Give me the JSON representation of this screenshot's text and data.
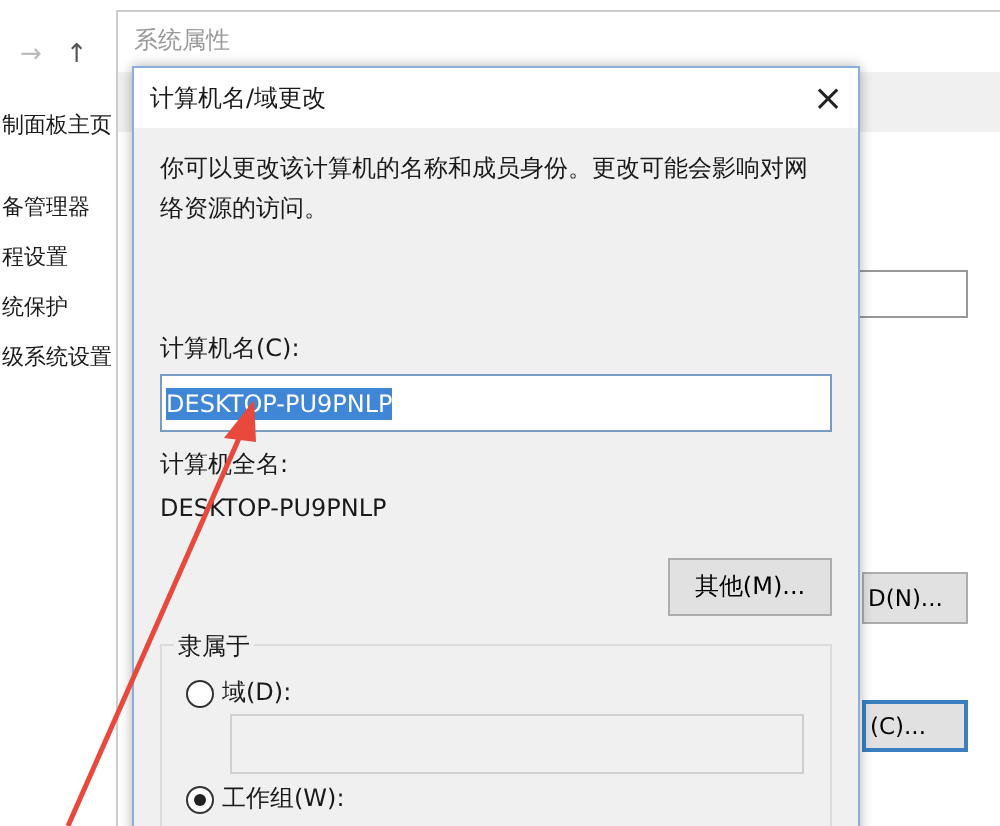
{
  "control_panel": {
    "nav": [
      "→",
      "↑"
    ],
    "sidebar": {
      "items": [
        {
          "label": "制面板主页"
        },
        {
          "label": "备管理器"
        },
        {
          "label": "程设置"
        },
        {
          "label": "统保护"
        },
        {
          "label": "级系统设置"
        }
      ]
    }
  },
  "system_properties": {
    "title": "系统属性",
    "buttons": [
      "D(N)...",
      "(C)..."
    ]
  },
  "dialog": {
    "title": "计算机名/域更改",
    "close": "×",
    "description": "你可以更改该计算机的名称和成员身份。更改可能会影响对网络资源的访问。",
    "name_label": "计算机名(C):",
    "name_value": "DESKTOP-PU9PNLP",
    "full_name_label": "计算机全名:",
    "full_name": "DESKTOP-PU9PNLP",
    "more_button": "其他(M)...",
    "member_of": {
      "title": "隶属于",
      "options": [
        {
          "label": "域(D):",
          "selected": false
        },
        {
          "label": "工作组(W):",
          "selected": true
        }
      ]
    }
  }
}
